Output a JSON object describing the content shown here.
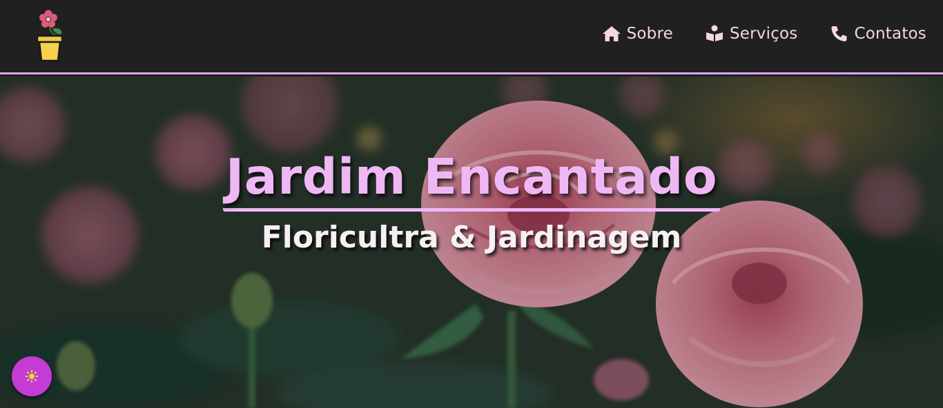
{
  "nav": {
    "items": [
      {
        "label": "Sobre",
        "icon": "home-icon"
      },
      {
        "label": "Serviços",
        "icon": "book-reader-icon"
      },
      {
        "label": "Contatos",
        "icon": "phone-icon"
      }
    ]
  },
  "hero": {
    "title": "Jardim Encantado",
    "subtitle": "Floricultra & Jardinagem"
  },
  "theme_toggle": {
    "icon": "sun-icon"
  },
  "colors": {
    "header_bg": "#202020",
    "accent": "#efb8f5",
    "nav_text": "#f4d6e6",
    "theme_button": "#c43bd6"
  }
}
